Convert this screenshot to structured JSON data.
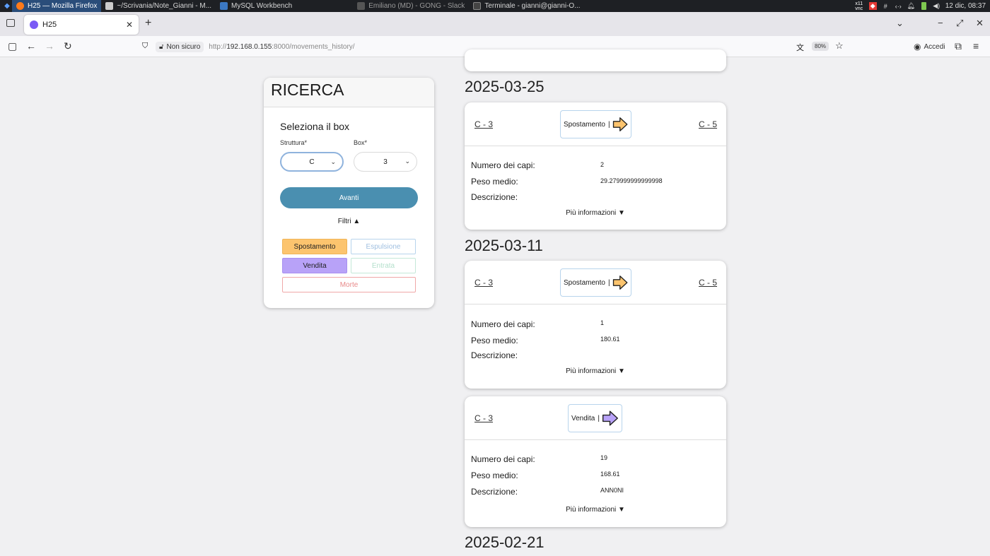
{
  "taskbar": {
    "tasks": [
      {
        "label": "H25 — Mozilla Firefox",
        "active": true
      },
      {
        "label": "~/Scrivania/Note_Gianni - M..."
      },
      {
        "label": "MySQL Workbench"
      },
      {
        "label": "Emiliano (MD) - GONG - Slack"
      },
      {
        "label": "Terminale - gianni@gianni-O..."
      }
    ],
    "tray_vnc": "x11 vnc",
    "clock": "12 dic, 08:37"
  },
  "browser": {
    "tab_title": "H25",
    "security_label": "Non sicuro",
    "url_prefix": "http://",
    "url_host": "192.168.0.155",
    "url_rest": ":8000/movements_history/",
    "zoom": "80%",
    "signin_label": "Accedi"
  },
  "search": {
    "title": "RICERCA",
    "select_title": "Seleziona il box",
    "struttura_label": "Struttura*",
    "struttura_value": "C",
    "box_label": "Box*",
    "box_value": "3",
    "submit": "Avanti",
    "filters_label": "Filtri ▲",
    "filters": {
      "spostamento": "Spostamento",
      "espulsione": "Espulsione",
      "vendita": "Vendita",
      "entrata": "Entrata",
      "morte": "Morte"
    }
  },
  "labels": {
    "numero": "Numero dei capi:",
    "peso": "Peso medio:",
    "descrizione": "Descrizione:",
    "more": "Più informazioni ▼"
  },
  "colors": {
    "spostamento": "#fcc46e",
    "vendita": "#b8a2f8",
    "avanti": "#4a8fb0"
  },
  "history": {
    "dates": [
      "2025-03-25",
      "2025-03-11",
      "2025-02-21"
    ],
    "movements": [
      {
        "from": "C - 3",
        "type": "Spostamento",
        "to": "C - 5",
        "numero": "2",
        "peso": "29.279999999999998",
        "descrizione": ""
      },
      {
        "from": "C - 3",
        "type": "Spostamento",
        "to": "C - 5",
        "numero": "1",
        "peso": "180.61",
        "descrizione": ""
      },
      {
        "from": "C - 3",
        "type": "Vendita",
        "to": "",
        "numero": "19",
        "peso": "168.61",
        "descrizione": "ANN0NI"
      }
    ]
  }
}
